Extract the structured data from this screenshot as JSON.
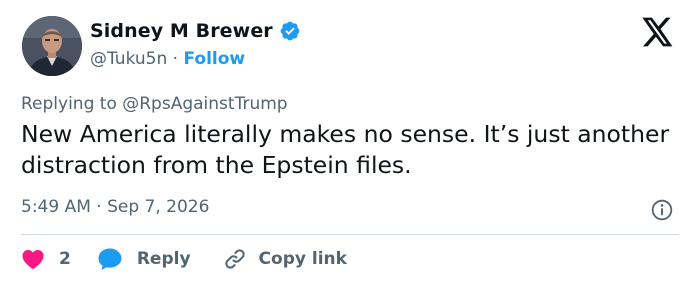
{
  "author": {
    "name": "Sidney M Brewer",
    "handle": "@Tuku5n",
    "separator": "·",
    "follow_label": "Follow"
  },
  "reply_context": {
    "prefix": "Replying to",
    "mention": "@RpsAgainstTrump"
  },
  "tweet": {
    "text": "New America literally makes no sense. It’s just another distraction from the Epstein files.",
    "time": "5:49 AM",
    "separator": "·",
    "date": "Sep 7, 2026"
  },
  "actions": {
    "like_count": "2",
    "reply_label": "Reply",
    "copy_label": "Copy link"
  },
  "icons": {
    "logo": "x-logo-icon",
    "verified": "verified-badge-icon",
    "info": "info-icon",
    "like": "heart-icon",
    "reply": "reply-bubble-icon",
    "copy": "link-icon"
  },
  "colors": {
    "accent": "#1d9bf0",
    "like": "#f91880",
    "text": "#0f1419",
    "muted": "#536471",
    "divider": "#cfd9de"
  }
}
